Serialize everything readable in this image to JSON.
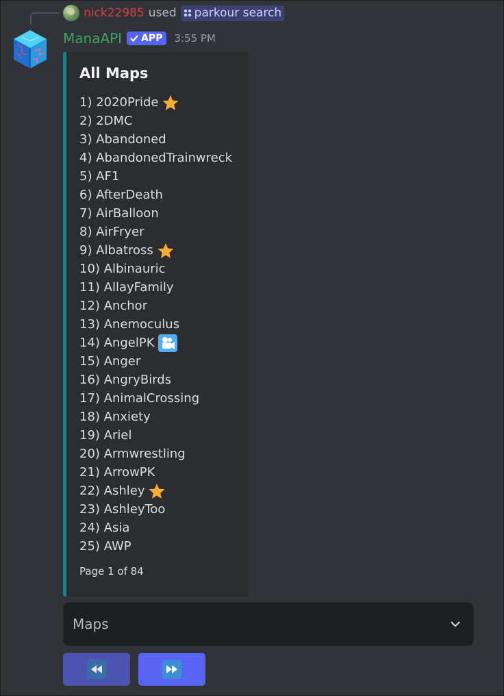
{
  "reply": {
    "username": "nick22985",
    "used_text": "used",
    "command": "parkour search"
  },
  "message": {
    "bot_name": "ManaAPI",
    "badge": "APP",
    "timestamp": "3:55 PM"
  },
  "embed": {
    "title": "All Maps",
    "accent_color": "#1e7f86",
    "items": [
      {
        "label": "1) 2020Pride",
        "icon": "star-icon"
      },
      {
        "label": "2) 2DMC",
        "icon": ""
      },
      {
        "label": "3) Abandoned",
        "icon": ""
      },
      {
        "label": "4) AbandonedTrainwreck",
        "icon": ""
      },
      {
        "label": "5) AF1",
        "icon": ""
      },
      {
        "label": "6) AfterDeath",
        "icon": ""
      },
      {
        "label": "7) AirBalloon",
        "icon": ""
      },
      {
        "label": "8) AirFryer",
        "icon": ""
      },
      {
        "label": "9) Albatross",
        "icon": "star-icon"
      },
      {
        "label": "10) Albinauric",
        "icon": ""
      },
      {
        "label": "11) AllayFamily",
        "icon": ""
      },
      {
        "label": "12) Anchor",
        "icon": ""
      },
      {
        "label": "13) Anemoculus",
        "icon": ""
      },
      {
        "label": "14) AngelPK",
        "icon": "movie-camera-icon"
      },
      {
        "label": "15) Anger",
        "icon": ""
      },
      {
        "label": "16) AngryBirds",
        "icon": ""
      },
      {
        "label": "17) AnimalCrossing",
        "icon": ""
      },
      {
        "label": "18) Anxiety",
        "icon": ""
      },
      {
        "label": "19) Ariel",
        "icon": ""
      },
      {
        "label": "20) Armwrestling",
        "icon": ""
      },
      {
        "label": "21) ArrowPK",
        "icon": ""
      },
      {
        "label": "22) Ashley",
        "icon": "star-icon"
      },
      {
        "label": "23) AshleyToo",
        "icon": ""
      },
      {
        "label": "24) Asia",
        "icon": ""
      },
      {
        "label": "25) AWP",
        "icon": ""
      }
    ],
    "footer": "Page 1 of 84"
  },
  "select": {
    "placeholder": "Maps"
  },
  "buttons": {
    "prev_icon": "rewind-icon",
    "next_icon": "fast-forward-icon"
  }
}
